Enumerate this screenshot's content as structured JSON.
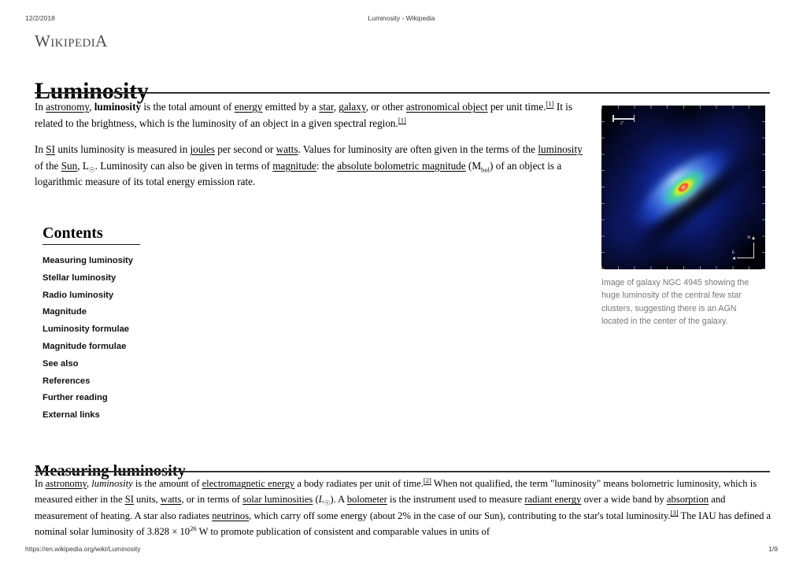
{
  "print_header": {
    "date": "12/2/2018",
    "doc_title": "Luminosity - Wikipedia"
  },
  "branding": {
    "wordmark": "WikipediA"
  },
  "article": {
    "title": "Luminosity",
    "intro": {
      "p1": {
        "t1": "In ",
        "link_astronomy": "astronomy",
        "t2": ", ",
        "bold_luminosity": "luminosity",
        "t3": " is the total amount of ",
        "link_energy": "energy",
        "t4": " emitted by a ",
        "link_star": "star",
        "t5": ", ",
        "link_galaxy": "galaxy",
        "t6": ", or other ",
        "link_astro_object": "astronomical object",
        "t7": " per unit time.",
        "ref1": "[1]",
        "t8": " It is related to the brightness, which is the luminosity of an object in a given spectral region.",
        "ref2": "[1]"
      },
      "p2": {
        "t1": "In ",
        "link_si": "SI",
        "t2": " units luminosity is measured in ",
        "link_joules": "joules",
        "t3": " per second or ",
        "link_watts": "watts",
        "t4": ". Values for luminosity are often given in the terms of the ",
        "link_luminosity": "luminosity",
        "t5": " of the ",
        "link_sun": "Sun",
        "t6": ", L",
        "sun_symbol": "☉",
        "t7": ". Luminosity can also be given in terms of ",
        "link_magnitude": "magnitude",
        "t8": ": the ",
        "link_abs_bol_mag": "absolute bolometric magnitude",
        "t9": " (M",
        "sub_bol": "bol",
        "t10": ") of an object is a logarithmic measure of its total energy emission rate."
      }
    }
  },
  "contents": {
    "heading": "Contents",
    "items": [
      {
        "label": "Measuring luminosity"
      },
      {
        "label": "Stellar luminosity"
      },
      {
        "label": "Radio luminosity"
      },
      {
        "label": "Magnitude"
      },
      {
        "label": "Luminosity formulae"
      },
      {
        "label": "Magnitude formulae"
      },
      {
        "label": "See also"
      },
      {
        "label": "References"
      },
      {
        "label": "Further reading"
      },
      {
        "label": "External links"
      }
    ]
  },
  "figure": {
    "scale_label": "2\"",
    "compass_n": "N",
    "compass_e": "E",
    "caption": "Image of galaxy NGC 4945 showing the huge luminosity of the central few star clusters, suggesting there is an AGN located in the center of the galaxy.",
    "colors": {
      "background": "#010108",
      "halo_blue": "#3c6eff",
      "core_green": "#78ff5a",
      "core_yellow": "#fffa3c",
      "core_red": "#ff5a28"
    }
  },
  "section_measuring": {
    "heading": "Measuring luminosity",
    "body": {
      "t1": "In ",
      "link_astronomy": "astronomy",
      "t2": ", ",
      "ital_luminosity": "luminosity",
      "t3": " is the amount of ",
      "link_em_energy": "electromagnetic energy",
      "t4": " a body radiates per unit of time.",
      "ref1": "[2]",
      "t5": " When not qualified, the term \"luminosity\" means bolometric luminosity, which is measured either in the ",
      "link_si": "SI",
      "t6": " units, ",
      "link_watts": "watts",
      "t7": ", or in terms of ",
      "link_solar_lum": "solar luminosities",
      "t8": " (",
      "ital_L": "L",
      "sun_symbol": "☉",
      "t9": "). A ",
      "link_bolometer": "bolometer",
      "t10": " is the instrument used to measure ",
      "link_radiant_energy": "radiant energy",
      "t11": " over a wide band by ",
      "link_absorption": "absorption",
      "t12": " and measurement of heating. A star also radiates ",
      "link_neutrinos": "neutrinos",
      "t13": ", which carry off some energy (about 2% in the case of our Sun), contributing to the star's total luminosity.",
      "ref2": "[3]",
      "t14": " The IAU has defined a nominal solar luminosity of ",
      "value_number": "3.828 × 10",
      "value_exponent": "26",
      "t15": " W to promote publication of consistent and comparable values in units of"
    }
  },
  "print_footer": {
    "url": "https://en.wikipedia.org/wiki/Luminosity",
    "page": "1/9"
  }
}
